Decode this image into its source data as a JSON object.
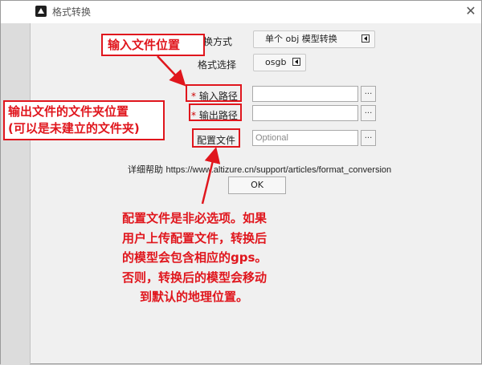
{
  "window": {
    "title": "格式转换",
    "close_glyph": "✕"
  },
  "form": {
    "method_label": "转换方式",
    "method_value": "单个 obj 模型转换",
    "format_label": "格式选择",
    "format_value": "osgb",
    "required_mark": "*",
    "input_label": "输入路径",
    "input_value": "",
    "output_label": "输出路径",
    "output_value": "",
    "config_label": "配置文件",
    "config_placeholder": "Optional",
    "browse_label": "...",
    "help_label": "详细帮助",
    "help_url": "https://www.altizure.cn/support/articles/format_conversion",
    "ok_label": "OK"
  },
  "annotations": {
    "input_note": "输入文件位置",
    "output_note_line1": "输出文件的文件夹位置",
    "output_note_line2": "(可以是未建立的文件夹)",
    "config_note": [
      "配置文件是非必选项。如果",
      "用户上传配置文件，转换后",
      "的模型会包含相应的gps。",
      "否则，转换后的模型会移动",
      "到默认的地理位置。"
    ],
    "color": "#e0161d"
  },
  "icons": {
    "app": "app-logo-icon",
    "close": "close-icon",
    "dropdown": "dropdown-arrow-icon"
  }
}
